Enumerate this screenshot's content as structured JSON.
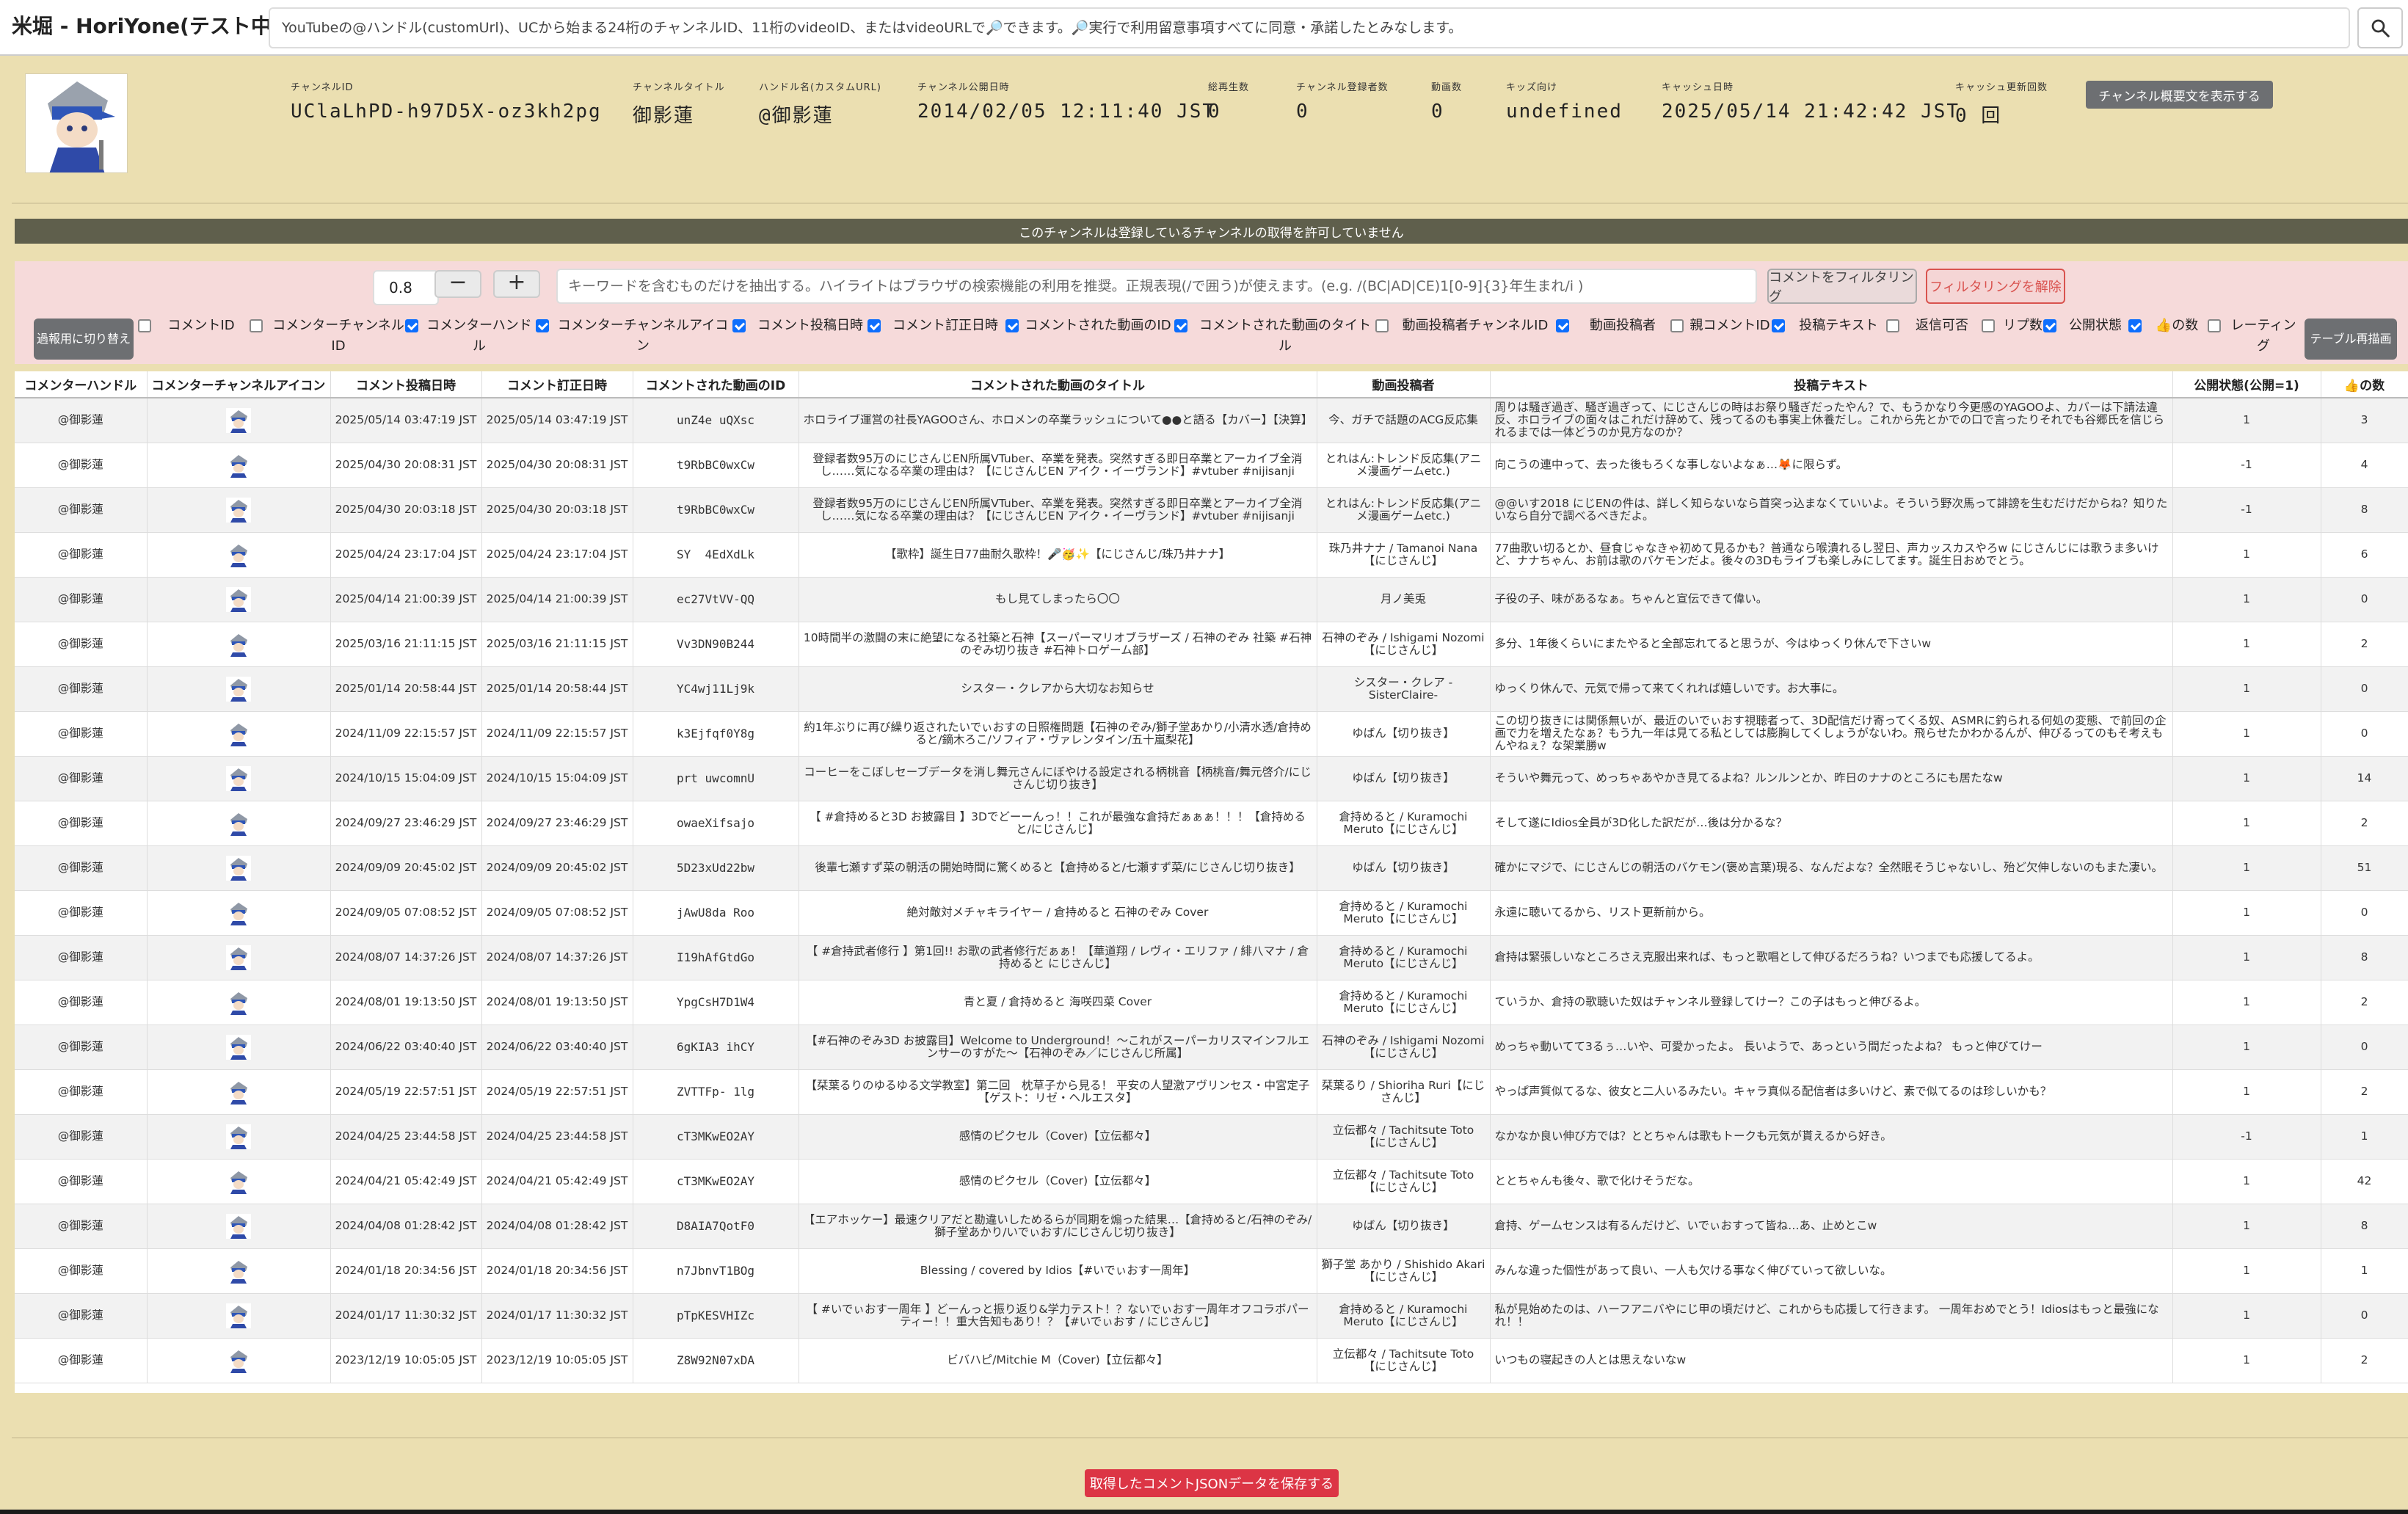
{
  "app": {
    "title": "米堀 - HoriYone(テスト中)"
  },
  "search": {
    "placeholder": "YouTubeの@ハンドル(customUrl)、UCから始まる24桁のチャンネルID、11桁のvideoID、またはvideoURLで🔎できます。🔎実行で利用留意事項すべてに同意・承諾したとみなします。",
    "icon": "search-icon"
  },
  "channel": {
    "fields": [
      {
        "label": "チャンネルID",
        "value": "UClaLhPD-h97D5X-oz3kh2pg"
      },
      {
        "label": "チャンネルタイトル",
        "value": "御影蓮"
      },
      {
        "label": "ハンドル名(カスタムURL)",
        "value": "@御影蓮"
      },
      {
        "label": "チャンネル公開日時",
        "value": "2014/02/05 12:11:40 JST"
      },
      {
        "label": "総再生数",
        "value": "0"
      },
      {
        "label": "チャンネル登録者数",
        "value": "0"
      },
      {
        "label": "動画数",
        "value": "0"
      },
      {
        "label": "キッズ向け",
        "value": "undefined"
      },
      {
        "label": "キャッシュ日時",
        "value": "2025/05/14 21:42:42 JST"
      },
      {
        "label": "キャッシュ更新回数",
        "value": "0 回"
      }
    ],
    "description_button": "チャンネル概要文を表示する"
  },
  "notice": "このチャンネルは登録しているチャンネルの取得を許可していません",
  "filter": {
    "threshold": "0.8",
    "minus": "−",
    "plus": "+",
    "keyword_placeholder": "キーワードを含むものだけを抽出する。ハイライトはブラウザの検索機能の利用を推奨。正規表現(/で囲う)が使えます。(e.g. /(BC|AD|CE)1[0-9]{3}年生まれ/i )",
    "apply_button": "コメントをフィルタリング",
    "clear_button": "フィルタリングを解除",
    "toggle_button": "過報用に切り替え",
    "redraw_button": "テーブル再描画",
    "columns": [
      {
        "label": "コメントID",
        "checked": false
      },
      {
        "label": "コメンターチャンネルID",
        "checked": false
      },
      {
        "label": "コメンターハンドル",
        "checked": true
      },
      {
        "label": "コメンターチャンネルアイコン",
        "checked": true
      },
      {
        "label": "コメント投稿日時",
        "checked": true
      },
      {
        "label": "コメント訂正日時",
        "checked": true
      },
      {
        "label": "コメントされた動画のID",
        "checked": true
      },
      {
        "label": "コメントされた動画のタイトル",
        "checked": true
      },
      {
        "label": "動画投稿者チャンネルID",
        "checked": false
      },
      {
        "label": "動画投稿者",
        "checked": true
      },
      {
        "label": "親コメントID",
        "checked": false
      },
      {
        "label": "投稿テキスト",
        "checked": true
      },
      {
        "label": "返信可否",
        "checked": false
      },
      {
        "label": "リプ数",
        "checked": false
      },
      {
        "label": "公開状態",
        "checked": true
      },
      {
        "label": "👍の数",
        "checked": true
      },
      {
        "label": "レーティング",
        "checked": false
      }
    ]
  },
  "table": {
    "headers": [
      "コメンターハンドル",
      "コメンターチャンネルアイコン",
      "コメント投稿日時",
      "コメント訂正日時",
      "コメントされた動画のID",
      "コメントされた動画のタイトル",
      "動画投稿者",
      "投稿テキスト",
      "公開状態(公開=1)",
      "👍の数"
    ],
    "rows": [
      [
        "@御影蓮",
        "",
        "2025/05/14 03:47:19 JST",
        "2025/05/14 03:47:19 JST",
        "unZ4e_uQXsc",
        "ホロライブ運営の社長YAGOOさん、ホロメンの卒業ラッシュについて●●と語る【カバー】【決算】",
        "今、ガチで話題のACG反応集",
        "周りは騒ぎ過ぎ、騒ぎ過ぎって、にじさんじの時はお祭り騒ぎだったやん？で、もうかなり今更感のYAGOOよ、カバーは下請法違反、ホロライブの面々はこれだけ辞めて、残ってるのも事実上休養だし。これから先とかでの口で言ったりそれでも谷郷氏を信じられるまでは一体どうのか見方なのか？",
        "1",
        "3"
      ],
      [
        "@御影蓮",
        "",
        "2025/04/30 20:08:31 JST",
        "2025/04/30 20:08:31 JST",
        "t9RbBC0wxCw",
        "登録者数95万のにじさんじEN所属VTuber、卒業を発表。突然すぎる即日卒業とアーカイブ全消し……気になる卒業の理由は？【にじさんじEN アイク・イーヴランド】#vtuber #nijisanji",
        "とれはん:トレンド反応集(アニメ漫画ゲームetc.)",
        "向こうの連中って、去った後もろくな事しないよなぁ…🦊に限らず。",
        "-1",
        "4"
      ],
      [
        "@御影蓮",
        "",
        "2025/04/30 20:03:18 JST",
        "2025/04/30 20:03:18 JST",
        "t9RbBC0wxCw",
        "登録者数95万のにじさんじEN所属VTuber、卒業を発表。突然すぎる即日卒業とアーカイブ全消し……気になる卒業の理由は？【にじさんじEN アイク・イーヴランド】#vtuber #nijisanji",
        "とれはん:トレンド反応集(アニメ漫画ゲームetc.)",
        "@@いす2018 にじENの件は、詳しく知らないなら首突っ込まなくていいよ。そういう野次馬って誹謗を生むだけだからね？知りたいなら自分で調べるべきだよ。",
        "-1",
        "8"
      ],
      [
        "@御影蓮",
        "",
        "2025/04/24 23:17:04 JST",
        "2025/04/24 23:17:04 JST",
        "SY__4EdXdLk",
        "【歌枠】誕生日77曲耐久歌枠！🎤🥳✨【にじさんじ/珠乃井ナナ】",
        "珠乃井ナナ / Tamanoi Nana【にじさんじ】",
        "77曲歌い切るとか、昼食じゃなきゃ初めて見るかも？普通なら喉潰れるし翌日、声カッスカスやろw にじさんじには歌うま多いけど、ナナちゃん、お前は歌のバケモンだよ。後々の3Dもライブも楽しみにしてます。誕生日おめでとう。",
        "1",
        "6"
      ],
      [
        "@御影蓮",
        "",
        "2025/04/14 21:00:39 JST",
        "2025/04/14 21:00:39 JST",
        "ec27VtVV-QQ",
        "もし見てしまったら〇〇",
        "月ノ美兎",
        "子役の子、味があるなぁ。ちゃんと宣伝できて偉い。",
        "1",
        "0"
      ],
      [
        "@御影蓮",
        "",
        "2025/03/16 21:11:15 JST",
        "2025/03/16 21:11:15 JST",
        "Vv3DN90B244",
        "10時間半の激闘の末に絶望になる社築と石神【スーパーマリオブラザーズ / 石神のぞみ 社築 #石神のぞみ切り抜き #石神トロゲーム部】",
        "石神のぞみ / Ishigami Nozomi【にじさんじ】",
        "多分、1年後くらいにまたやると全部忘れてると思うが、今はゆっくり休んで下さいw",
        "1",
        "2"
      ],
      [
        "@御影蓮",
        "",
        "2025/01/14 20:58:44 JST",
        "2025/01/14 20:58:44 JST",
        "YC4wj11Lj9k",
        "シスター・クレアから大切なお知らせ",
        "シスター・クレア - SisterClaire-",
        "ゆっくり休んで、元気で帰って来てくれれば嬉しいです。お大事に。",
        "1",
        "0"
      ],
      [
        "@御影蓮",
        "",
        "2024/11/09 22:15:57 JST",
        "2024/11/09 22:15:57 JST",
        "k3Ejfqf0Y8g",
        "約1年ぶりに再び繰り返されたいでぃおすの日照権問題【石神のぞみ/獅子堂あかり/小清水透/倉持めると/鏑木ろこ/ソフィア・ヴァレンタイン/五十嵐梨花】",
        "ゆばん【切り抜き】",
        "この切り抜きには関係無いが、最近のいでぃおす視聴者って、3D配信だけ寄ってくる奴、ASMRに釣られる何処の変態、で前回の企画で力を増えたなぁ？もう九一年は見てる私としては膨胸してくしょうがないわ。飛らせたかわかるんが、伸びるってのもそ考えもんやねぇ？な架業勝w",
        "1",
        "0"
      ],
      [
        "@御影蓮",
        "",
        "2024/10/15 15:04:09 JST",
        "2024/10/15 15:04:09 JST",
        "prt_uwcomnU",
        "コーヒーをこぼしセーブデータを消し舞元さんにぼやける設定される柄桃音【柄桃音/舞元啓介/にじさんじ切り抜き】",
        "ゆばん【切り抜き】",
        "そういや舞元って、めっちゃあやかき見てるよね？ルンルンとか、昨日のナナのところにも居たなw",
        "1",
        "14"
      ],
      [
        "@御影蓮",
        "",
        "2024/09/27 23:46:29 JST",
        "2024/09/27 23:46:29 JST",
        "owaeXifsajo",
        "【 #倉持めると3D お披露目 】3Dでどーーんっ！！これが最強な倉持だぁぁぁ！！！【倉持めると/にじさんじ】",
        "倉持めると / Kuramochi Meruto【にじさんじ】",
        "そして遂にIdios全員が3D化した訳だが…後は分かるな？",
        "1",
        "2"
      ],
      [
        "@御影蓮",
        "",
        "2024/09/09 20:45:02 JST",
        "2024/09/09 20:45:02 JST",
        "5D23xUd22bw",
        "後輩七瀬すず菜の朝活の開始時間に驚くめると【倉持めると/七瀬すず菜/にじさんじ切り抜き】",
        "ゆばん【切り抜き】",
        "確かにマジで、にじさんじの朝活のバケモン(褒め言葉)現る、なんだよな？全然眠そうじゃないし、殆ど欠伸しないのもまた凄い。",
        "1",
        "51"
      ],
      [
        "@御影蓮",
        "",
        "2024/09/05 07:08:52 JST",
        "2024/09/05 07:08:52 JST",
        "jAwU8da_Roo",
        "絶対敵対メチャキライヤー / 倉持めると 石神のぞみ Cover",
        "倉持めると / Kuramochi Meruto【にじさんじ】",
        "永遠に聴いてるから、リスト更新前から。",
        "1",
        "0"
      ],
      [
        "@御影蓮",
        "",
        "2024/08/07 14:37:26 JST",
        "2024/08/07 14:37:26 JST",
        "I19hAfGtdGo",
        "【 #倉持武者修行 】第1回!! お歌の武者修行だぁぁ！【華道翔 / レヴィ・エリファ / 緋八マナ / 倉持めると にじさんじ】",
        "倉持めると / Kuramochi Meruto【にじさんじ】",
        "倉持は緊張しいなところさえ克服出来れば、もっと歌唱として伸びるだろうね？いつまでも応援してるよ。",
        "1",
        "8"
      ],
      [
        "@御影蓮",
        "",
        "2024/08/01 19:13:50 JST",
        "2024/08/01 19:13:50 JST",
        "YpgCsH7D1W4",
        "青と夏 / 倉持めると 海咲四菜 Cover",
        "倉持めると / Kuramochi Meruto【にじさんじ】",
        "ていうか、倉持の歌聴いた奴はチャンネル登録してけー？この子はもっと伸びるよ。",
        "1",
        "2"
      ],
      [
        "@御影蓮",
        "",
        "2024/06/22 03:40:40 JST",
        "2024/06/22 03:40:40 JST",
        "6gKIA3_ihCY",
        "【#石神のぞみ3D お披露目】Welcome to Underground！～これがスーパーカリスマインフルエンサーのすがた～【石神のぞみ／にじさんじ所属】",
        "石神のぞみ / Ishigami Nozomi【にじさんじ】",
        "めっちゃ動いてて3るぅ…いや、可愛かったよ。 長いようで、あっという間だったよね？ もっと伸びてけー",
        "1",
        "0"
      ],
      [
        "@御影蓮",
        "",
        "2024/05/19 22:57:51 JST",
        "2024/05/19 22:57:51 JST",
        "ZVTTFp-_1lg",
        "【栞葉るりのゆるゆる文学教室】第二回　枕草子から見る！ 平安の人望激アヴリンセス・中宮定子【ゲスト：リゼ・ヘルエスタ】",
        "栞葉るり / Shioriha Ruri【にじさんじ】",
        "やっぱ声質似てるな、彼女と二人いるみたい。キャラ真似る配信者は多いけど、素で似てるのは珍しいかも？",
        "1",
        "2"
      ],
      [
        "@御影蓮",
        "",
        "2024/04/25 23:44:58 JST",
        "2024/04/25 23:44:58 JST",
        "cT3MKwEO2AY",
        "感情のピクセル（Cover)【立伝都々】",
        "立伝都々 / Tachitsute Toto【にじさんじ】",
        "なかなか良い伸び方では？ととちゃんは歌もトークも元気が貰えるから好き。",
        "-1",
        "1"
      ],
      [
        "@御影蓮",
        "",
        "2024/04/21 05:42:49 JST",
        "2024/04/21 05:42:49 JST",
        "cT3MKwEO2AY",
        "感情のピクセル（Cover)【立伝都々】",
        "立伝都々 / Tachitsute Toto【にじさんじ】",
        "ととちゃんも後々、歌で化けそうだな。",
        "1",
        "42"
      ],
      [
        "@御影蓮",
        "",
        "2024/04/08 01:28:42 JST",
        "2024/04/08 01:28:42 JST",
        "D8AIA7QotF0",
        "【エアホッケー】最速クリアだと勘違いしためるらが同期を煽った結果…【倉持めると/石神のぞみ/獅子堂あかり/いでぃおす/にじさんじ切り抜き】",
        "ゆばん【切り抜き】",
        "倉持、ゲームセンスは有るんだけど、いでぃおすって皆ね…あ、止めとこw",
        "1",
        "8"
      ],
      [
        "@御影蓮",
        "",
        "2024/01/18 20:34:56 JST",
        "2024/01/18 20:34:56 JST",
        "n7JbnvT1BOg",
        "Blessing / covered by Idios【#いでぃおす一周年】",
        "獅子堂 あかり / Shishido Akari【にじさんじ】",
        "みんな違った個性があって良い、一人も欠ける事なく伸びていって欲しいな。",
        "1",
        "1"
      ],
      [
        "@御影蓮",
        "",
        "2024/01/17 11:30:32 JST",
        "2024/01/17 11:30:32 JST",
        "pTpKESVHIZc",
        "【 #いでぃおす一周年 】どーんっと振り返り&学力テスト！？ないでぃおす一周年オフコラボパーティー！！重大告知もあり！？【#いでぃおす / にじさんじ】",
        "倉持めると / Kuramochi Meruto【にじさんじ】",
        "私が見始めたのは、ハーフアニバやにじ甲の頃だけど、これからも応援して行きます。 一周年おめでとう！Idiosはもっと最強になれ！！",
        "1",
        "0"
      ],
      [
        "@御影蓮",
        "",
        "2023/12/19 10:05:05 JST",
        "2023/12/19 10:05:05 JST",
        "Z8W92N07xDA",
        "ビバハピ/Mitchie M（Cover)【立伝都々】",
        "立伝都々 / Tachitsute Toto【にじさんじ】",
        "いつもの寝起きの人とは思えないなw",
        "1",
        "2"
      ]
    ]
  },
  "save_button": "取得したコメントJSONデータを保存する",
  "colors": {
    "background": "#ebdfb1",
    "filter_panel": "#f6dada",
    "notice_bar": "#5f5f4c",
    "danger": "#dc3545",
    "primary": "#0d6efd"
  }
}
